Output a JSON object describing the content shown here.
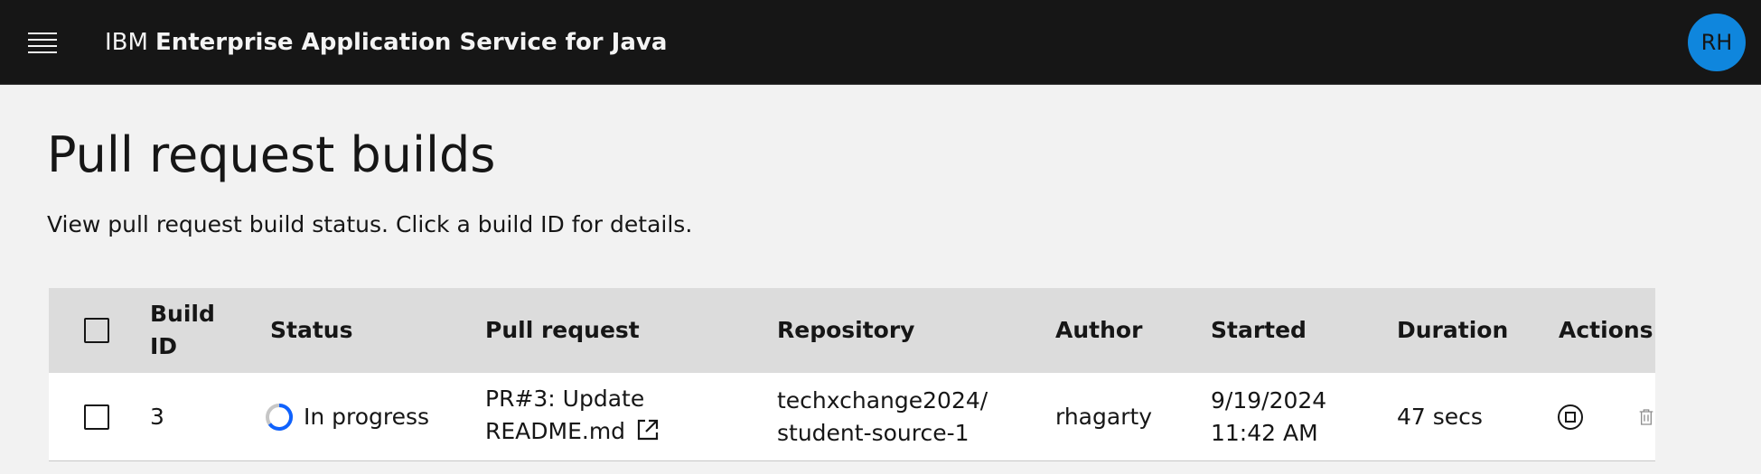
{
  "header": {
    "menu_icon": "hamburger-menu-icon",
    "brand_prefix": "IBM",
    "brand_product": "Enterprise Application Service for Java",
    "avatar_initials": "RH",
    "avatar_color": "#0f86dd"
  },
  "page": {
    "title": "Pull request builds",
    "description": "View pull request build status. Click a build ID for details."
  },
  "table": {
    "columns": {
      "build_id": "Build ID",
      "status": "Status",
      "pull_request": "Pull request",
      "repository": "Repository",
      "author": "Author",
      "started": "Started",
      "duration": "Duration",
      "actions": "Actions"
    },
    "rows": [
      {
        "build_id": "3",
        "status": "In progress",
        "status_icon": "in-progress-spinner-icon",
        "pr_line1": "PR#3: Update",
        "pr_line2": "README.md",
        "repo_line1": "techxchange2024/",
        "repo_line2": "student-source-1",
        "author": "rhagarty",
        "started_line1": "9/19/2024",
        "started_line2": "11:42 AM",
        "duration": "47 secs",
        "actions": [
          "stop-icon",
          "trash-icon"
        ]
      }
    ]
  },
  "colors": {
    "header_bg": "#161616",
    "page_bg": "#f2f2f2",
    "table_header_bg": "#dcdcdc",
    "row_bg": "#ffffff",
    "spinner": "#0f62fe"
  }
}
